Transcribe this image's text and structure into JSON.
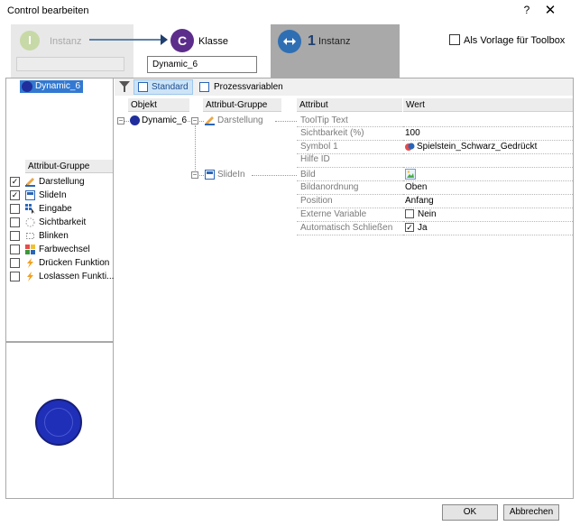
{
  "window": {
    "title": "Control bearbeiten",
    "help": "?",
    "close": "✕"
  },
  "wizard": {
    "step1": {
      "letter": "I",
      "label": "Instanz"
    },
    "step2": {
      "letter": "C",
      "label": "Klasse",
      "value": "Dynamic_6"
    },
    "step3": {
      "number": "1",
      "label": "Instanz"
    },
    "template_checkbox": {
      "label": "Als Vorlage für Toolbox",
      "checked": false
    }
  },
  "left": {
    "selected_object": "Dynamic_6",
    "attribute_group_header": "Attribut-Gruppe",
    "groups": [
      {
        "label": "Darstellung",
        "checked": true,
        "icon": "pencil-icon"
      },
      {
        "label": "SlideIn",
        "checked": true,
        "icon": "window-icon"
      },
      {
        "label": "Eingabe",
        "checked": false,
        "icon": "grid-cursor-icon"
      },
      {
        "label": "Sichtbarkeit",
        "checked": false,
        "icon": "dotted-circle-icon"
      },
      {
        "label": "Blinken",
        "checked": false,
        "icon": "blink-icon"
      },
      {
        "label": "Farbwechsel",
        "checked": false,
        "icon": "color-squares-icon"
      },
      {
        "label": "Drücken Funktion",
        "checked": false,
        "icon": "lightning-icon"
      },
      {
        "label": "Loslassen Funkti...",
        "checked": false,
        "icon": "lightning-icon"
      }
    ]
  },
  "toolbar": {
    "standard": "Standard",
    "process_vars": "Prozessvariablen"
  },
  "grid": {
    "headers": {
      "object": "Objekt",
      "group": "Attribut-Gruppe",
      "attribute": "Attribut",
      "value": "Wert"
    },
    "object_name": "Dynamic_6",
    "group1": "Darstellung",
    "group2": "SlideIn",
    "darstellung_rows": [
      {
        "attr": "ToolTip Text",
        "value": ""
      },
      {
        "attr": "Sichtbarkeit (%)",
        "value": "100"
      },
      {
        "attr": "Symbol 1",
        "value": "Spielstein_Schwarz_Gedrückt"
      },
      {
        "attr": "Hilfe ID",
        "value": ""
      }
    ],
    "slidein_rows": [
      {
        "attr": "Bild",
        "value": ""
      },
      {
        "attr": "Bildanordnung",
        "value": "Oben"
      },
      {
        "attr": "Position",
        "value": "Anfang"
      },
      {
        "attr": "Externe Variable",
        "value": "Nein"
      },
      {
        "attr": "Automatisch Schließen",
        "value": "Ja"
      }
    ]
  },
  "buttons": {
    "ok": "OK",
    "cancel": "Abbrechen"
  }
}
